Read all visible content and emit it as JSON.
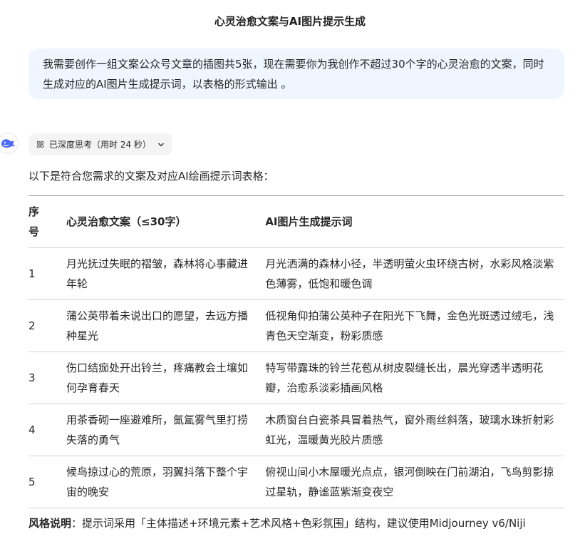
{
  "page": {
    "title": "心灵治愈文案与AI图片提示生成"
  },
  "user_message": {
    "text": "我需要创作一组文案公众号文章的插图共5张，现在需要你为我创作不超过30个字的心灵治愈的文案，同时生成对应的AI图片生成提示词，以表格的形式输出 。"
  },
  "assistant": {
    "think_label": "已深度思考（用时 24 秒）",
    "intro": "以下是符合您需求的文案及对应AI绘画提示词表格：",
    "table": {
      "headers": [
        "序号",
        "心灵治愈文案（≤30字）",
        "AI图片生成提示词"
      ],
      "rows": [
        {
          "index": "1",
          "copy": "月光抚过失眠的褶皱，森林将心事藏进年轮",
          "prompt": "月光洒满的森林小径，半透明萤火虫环绕古树，水彩风格淡紫色薄雾，低饱和暖色调"
        },
        {
          "index": "2",
          "copy": "蒲公英带着未说出口的愿望，去远方播种星光",
          "prompt": "低视角仰拍蒲公英种子在阳光下飞舞，金色光斑透过绒毛，浅青色天空渐变，粉彩质感"
        },
        {
          "index": "3",
          "copy": "伤口结痂处开出铃兰，疼痛教会土壤如何孕育春天",
          "prompt": "特写带露珠的铃兰花苞从树皮裂缝长出，晨光穿透半透明花瓣，治愈系淡彩插画风格"
        },
        {
          "index": "4",
          "copy": "用茶香砌一座避难所，氤氲雾气里打捞失落的勇气",
          "prompt": "木质窗台白瓷茶具冒着热气，窗外雨丝斜落，玻璃水珠折射彩虹光，温暖黄光胶片质感"
        },
        {
          "index": "5",
          "copy": "候鸟掠过心的荒原，羽翼抖落下整个宇宙的晚安",
          "prompt": "俯视山间小木屋暖光点点，银河倒映在门前湖泊，飞鸟剪影掠过星轨，静谧蓝紫渐变夜空"
        }
      ]
    },
    "style_note": {
      "label": "风格说明",
      "text": "：提示词采用「主体描述+环境元素+艺术风格+色彩氛围」结构，建议使用Midjourney v6/Niji"
    }
  },
  "colors": {
    "user_bubble_bg": "#eff6ff",
    "think_pill_bg": "#f4f4f5",
    "logo_blue": "#4d6bfe",
    "text": "#262626"
  },
  "icons": {
    "assistant_logo": "whale-logo-icon",
    "think": "atom-icon",
    "expand": "chevron-down-icon"
  }
}
